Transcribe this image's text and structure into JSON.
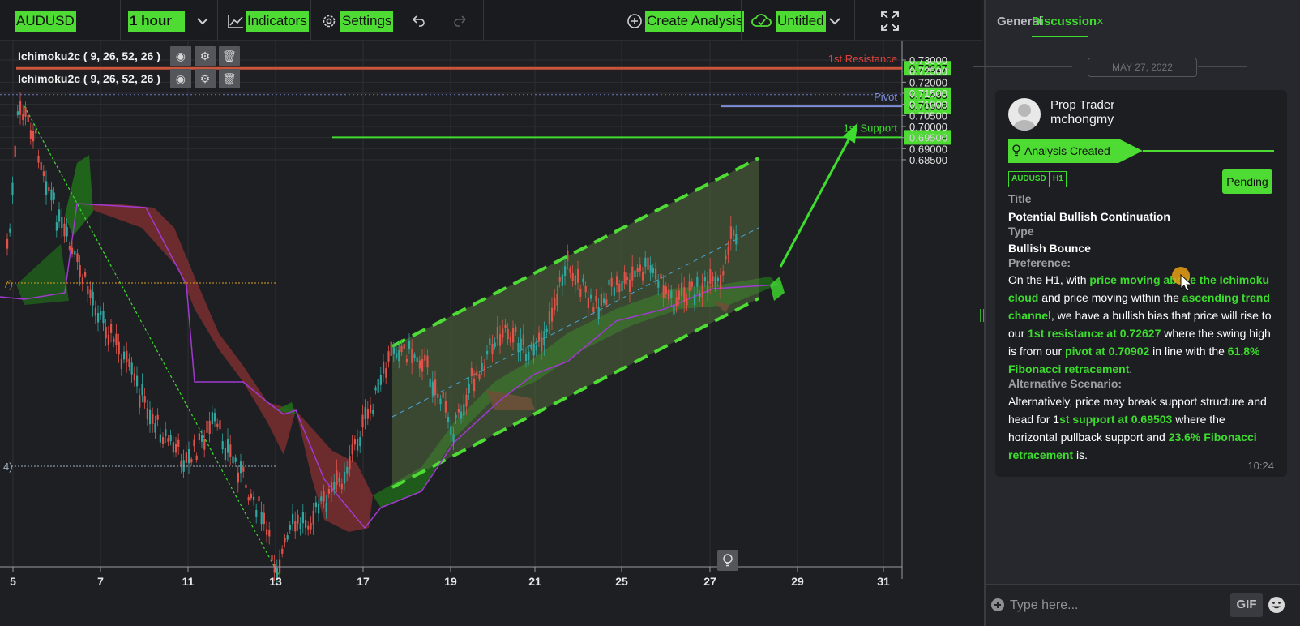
{
  "toolbar": {
    "symbol": "AUDUSD",
    "timeframe": "1 hour",
    "indicators_label": "Indicators",
    "settings_label": "Settings",
    "create_analysis_label": "Create Analysis",
    "layout_name": "Untitled"
  },
  "indicators": [
    {
      "label": "Ichimoku2c ( 9, 26, 52, 26 )"
    },
    {
      "label": "Ichimoku2c ( 9, 26, 52, 26 )"
    }
  ],
  "chart": {
    "y_ticks": [
      "0.73000",
      "0.72500",
      "0.72000",
      "0.71500",
      "0.71000",
      "0.70500",
      "0.70000",
      "0.69500",
      "0.69000",
      "0.68500"
    ],
    "x_ticks": [
      "5",
      "7",
      "11",
      "13",
      "17",
      "19",
      "21",
      "25",
      "27",
      "29",
      "31"
    ],
    "lines": {
      "resistance": {
        "label": "1st Resistance",
        "value": "0.72627",
        "color": "#e0423a"
      },
      "pivot": {
        "label": "Pivot",
        "value": "0.70908",
        "color": "#7f8fd8"
      },
      "support": {
        "label": "1st Support",
        "value": "0.69509",
        "color": "#3ddc2e"
      },
      "current": {
        "value": "0.71435"
      }
    },
    "left_edge_labels": [
      "7)",
      "4)"
    ]
  },
  "side": {
    "tabs": {
      "general": "General",
      "discussion": "Discussion"
    },
    "close_char": "×",
    "date": "MAY 27, 2022",
    "post": {
      "author_name": "Prop Trader",
      "author_handle": "mchongmy",
      "status": "Analysis Created",
      "badges": [
        "AUDUSD",
        "H1"
      ],
      "state": "Pending",
      "title_label": "Title",
      "title_value": "Potential Bullish Continuation",
      "type_label": "Type",
      "type_value": "Bullish Bounce",
      "preference_label": "Preference:",
      "preference_parts": [
        {
          "t": "On the H1, with ",
          "g": false
        },
        {
          "t": "price moving above the Ichimoku cloud",
          "g": true
        },
        {
          "t": " and price moving within the ",
          "g": false
        },
        {
          "t": "ascending trend channel",
          "g": true
        },
        {
          "t": ", we have a bullish bias that price will rise to our ",
          "g": false
        },
        {
          "t": "1st resistance at 0.72627",
          "g": true
        },
        {
          "t": " where the swing high is from our ",
          "g": false
        },
        {
          "t": "pivot  at 0.70902",
          "g": true
        },
        {
          "t": " in line with the ",
          "g": false
        },
        {
          "t": "61.8% Fibonacci retracement",
          "g": true
        },
        {
          "t": ".",
          "g": false
        }
      ],
      "alt_label": "Alternative Scenario:",
      "alt_parts": [
        {
          "t": "Alternatively, price may break support structure and head for 1",
          "g": false
        },
        {
          "t": "st support at 0.69503",
          "g": true
        },
        {
          "t": " where the horizontal pullback support and ",
          "g": false
        },
        {
          "t": "23.6% Fibonacci retracement",
          "g": true
        },
        {
          "t": " is.",
          "g": false
        }
      ],
      "time": "10:24"
    },
    "input_placeholder": "Type here...",
    "gif_label": "GIF"
  }
}
